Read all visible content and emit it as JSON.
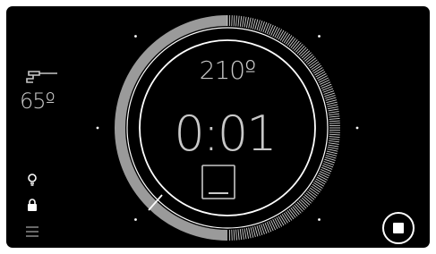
{
  "oven": {
    "temperature": "210º",
    "timer": "0:01",
    "probe_temperature": "65º",
    "cook_progress": 0.5,
    "colors": {
      "background": "#000000",
      "foreground": "#c8c8c8",
      "track": "#9a9a9a"
    }
  },
  "icons": {
    "probe": "meat-probe-icon",
    "mode": "bottom-heat-mode-icon",
    "light": "oven-light-icon",
    "lock": "child-lock-icon",
    "menu": "menu-icon",
    "stop": "stop-icon"
  }
}
